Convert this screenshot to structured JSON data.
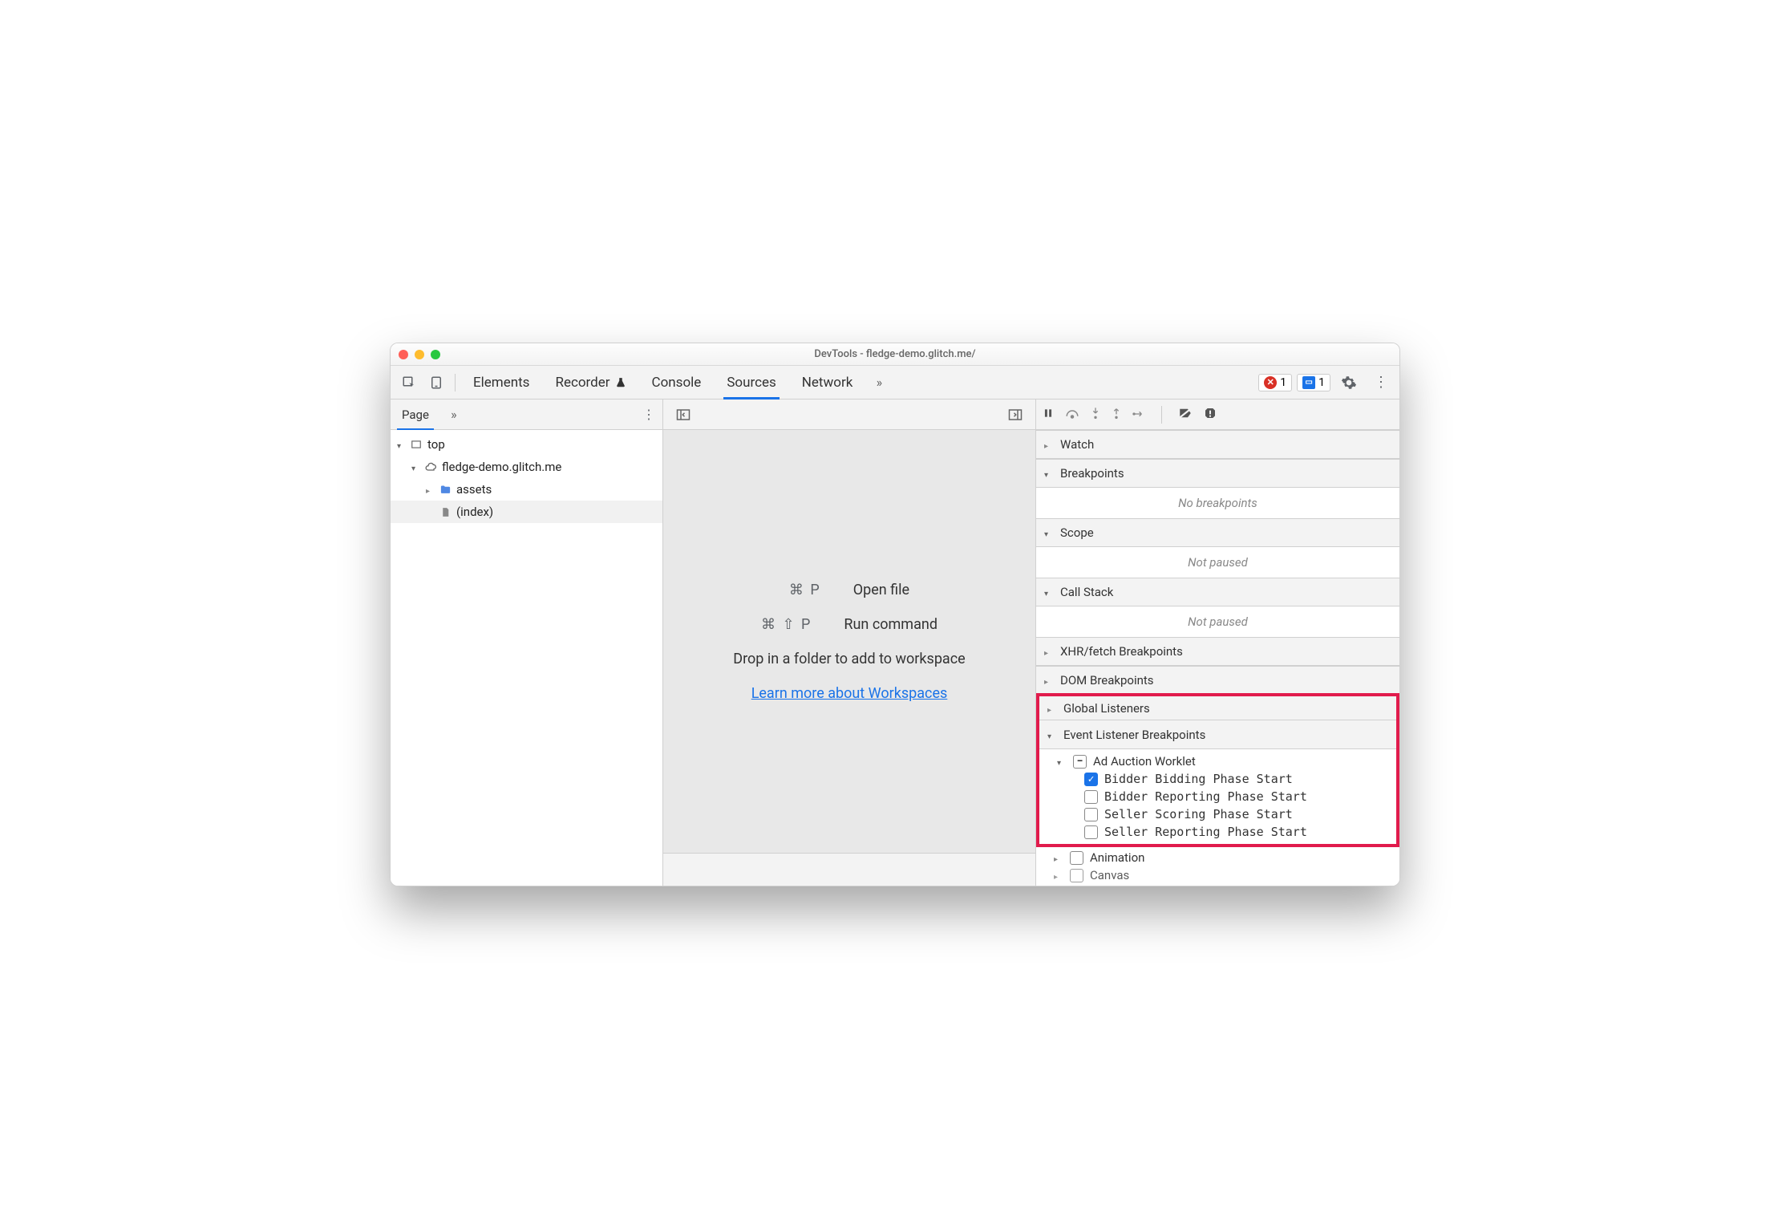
{
  "window": {
    "title": "DevTools - fledge-demo.glitch.me/"
  },
  "tabs": {
    "elements": "Elements",
    "recorder": "Recorder",
    "console": "Console",
    "sources": "Sources",
    "network": "Network"
  },
  "badges": {
    "errors": "1",
    "messages": "1"
  },
  "page_nav": {
    "page": "Page"
  },
  "tree": {
    "top": "top",
    "domain": "fledge-demo.glitch.me",
    "assets": "assets",
    "index": "(index)"
  },
  "mid": {
    "open_kbd": "⌘ P",
    "open_label": "Open file",
    "run_kbd": "⌘ ⇧ P",
    "run_label": "Run command",
    "drop": "Drop in a folder to add to workspace",
    "learn": "Learn more about Workspaces"
  },
  "debug": {
    "watch": "Watch",
    "breakpoints": "Breakpoints",
    "no_breakpoints": "No breakpoints",
    "scope": "Scope",
    "not_paused1": "Not paused",
    "callstack": "Call Stack",
    "not_paused2": "Not paused",
    "xhr": "XHR/fetch Breakpoints",
    "dom": "DOM Breakpoints",
    "global": "Global Listeners",
    "evlist": "Event Listener Breakpoints",
    "ad_auction": "Ad Auction Worklet",
    "ev1": "Bidder Bidding Phase Start",
    "ev2": "Bidder Reporting Phase Start",
    "ev3": "Seller Scoring Phase Start",
    "ev4": "Seller Reporting Phase Start",
    "animation": "Animation",
    "canvas": "Canvas"
  }
}
